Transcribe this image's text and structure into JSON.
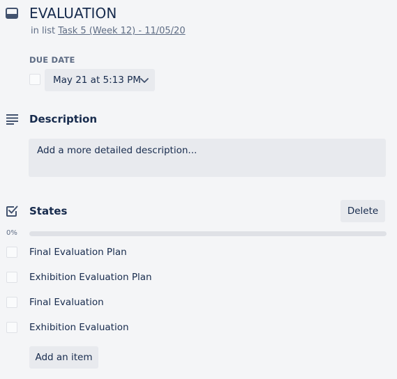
{
  "header": {
    "icon": "card-icon",
    "title": "EVALUATION",
    "in_list_prefix": "in list",
    "list_link": "Task 5 (Week 12) - 11/05/20"
  },
  "due_date": {
    "label": "DUE DATE",
    "value": "May 21 at 5:13 PM",
    "checked": false,
    "icon": "chevron-down-icon"
  },
  "description": {
    "icon": "description-lines-icon",
    "title": "Description",
    "placeholder": "Add a more detailed description..."
  },
  "checklist": {
    "icon": "checklist-icon",
    "title": "States",
    "delete_label": "Delete",
    "progress_text": "0%",
    "progress": 0,
    "items": [
      {
        "label": "Final Evaluation Plan",
        "checked": false
      },
      {
        "label": "Exhibition Evaluation Plan",
        "checked": false
      },
      {
        "label": "Final Evaluation",
        "checked": false
      },
      {
        "label": "Exhibition Evaluation",
        "checked": false
      }
    ],
    "add_item_label": "Add an item"
  },
  "colors": {
    "background": "#f4f5f7",
    "button_bg": "#e8eaee",
    "text": "#172b4d",
    "muted": "#5e6c84",
    "progress_track": "#dfe1e6"
  }
}
